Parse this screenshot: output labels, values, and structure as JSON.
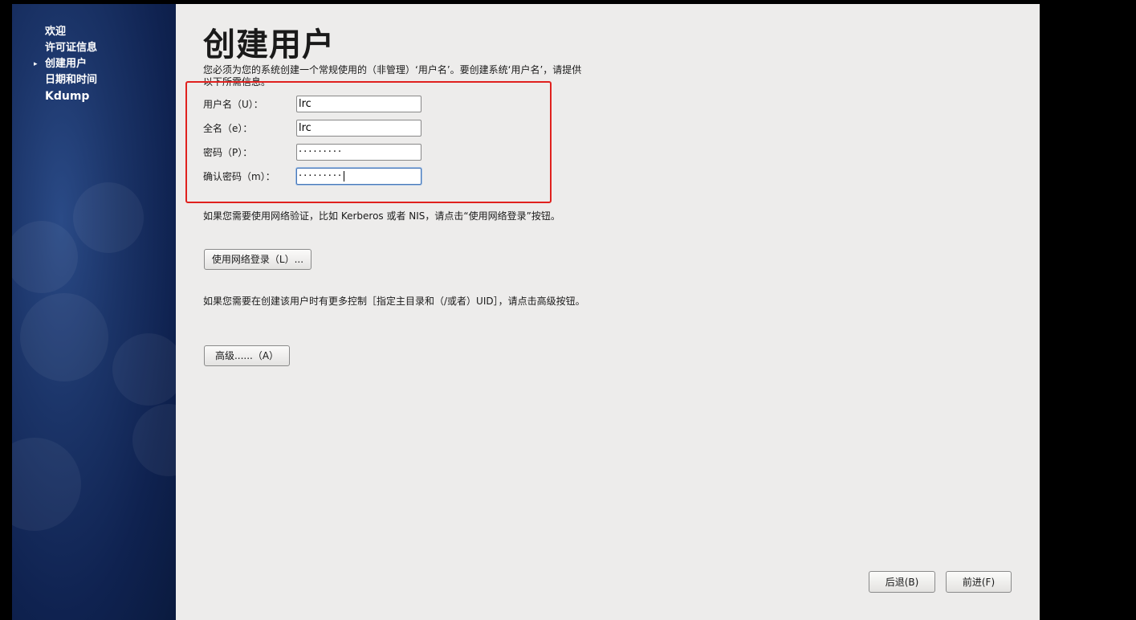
{
  "sidebar": {
    "items": [
      {
        "label": "欢迎"
      },
      {
        "label": "许可证信息"
      },
      {
        "label": "创建用户",
        "marker": "▸"
      },
      {
        "label": "日期和时间"
      },
      {
        "label": "Kdump"
      }
    ]
  },
  "main": {
    "title": "创建用户",
    "intro": "您必须为您的系统创建一个常规使用的（非管理）‘用户名’。要创建系统‘用户名’，请提供以下所需信息。",
    "form": {
      "username_label": "用户名（U）：",
      "username_value": "lrc",
      "fullname_label": "全名（e）：",
      "fullname_value": "lrc",
      "password_label": "密码（P）：",
      "password_value": "·········",
      "confirm_label": "确认密码（m）：",
      "confirm_value": "·········"
    },
    "network_text": "如果您需要使用网络验证，比如 Kerberos 或者 NIS，请点击“使用网络登录”按钮。",
    "network_button": "使用网络登录（L）...",
    "advanced_text": "如果您需要在创建该用户时有更多控制［指定主目录和（/或者）UID］，请点击高级按钮。",
    "advanced_button": "高级......（A）"
  },
  "footer": {
    "back_button": "后退(B)",
    "next_button": "前进(F)"
  },
  "colors": {
    "sidebar_bg": "#1b3468",
    "main_bg": "#edeceb",
    "highlight_border": "#e0211e",
    "focus_border": "#4a79b8"
  }
}
